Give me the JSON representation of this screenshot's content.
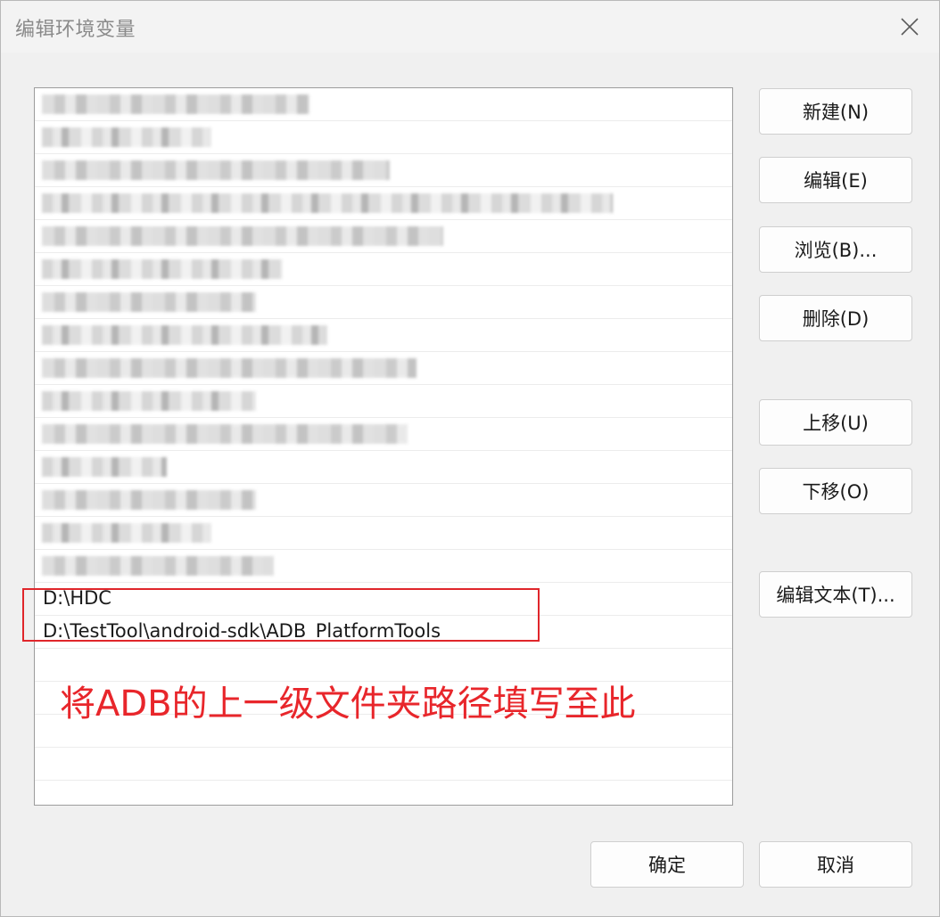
{
  "window": {
    "title": "编辑环境变量"
  },
  "list": {
    "rows": [
      {
        "text": "",
        "redacted": true
      },
      {
        "text": "",
        "redacted": true
      },
      {
        "text": "",
        "redacted": true
      },
      {
        "text": "",
        "redacted": true
      },
      {
        "text": "",
        "redacted": true
      },
      {
        "text": "",
        "redacted": true
      },
      {
        "text": "",
        "redacted": true
      },
      {
        "text": "",
        "redacted": true
      },
      {
        "text": "",
        "redacted": true
      },
      {
        "text": "",
        "redacted": true
      },
      {
        "text": "",
        "redacted": true
      },
      {
        "text": "",
        "redacted": true
      },
      {
        "text": "",
        "redacted": true
      },
      {
        "text": "",
        "redacted": true
      },
      {
        "text": "",
        "redacted": true
      },
      {
        "text": "D:\\HDC",
        "redacted": false
      },
      {
        "text": "D:\\TestTool\\android-sdk\\ADB_PlatformTools",
        "redacted": false
      }
    ]
  },
  "annotation": {
    "text": "将ADB的上一级文件夹路径填写至此",
    "color": "#e8262b"
  },
  "buttons": {
    "new": "新建(N)",
    "edit": "编辑(E)",
    "browse": "浏览(B)...",
    "delete": "删除(D)",
    "move_up": "上移(U)",
    "move_down": "下移(O)",
    "edit_text": "编辑文本(T)...",
    "ok": "确定",
    "cancel": "取消"
  }
}
